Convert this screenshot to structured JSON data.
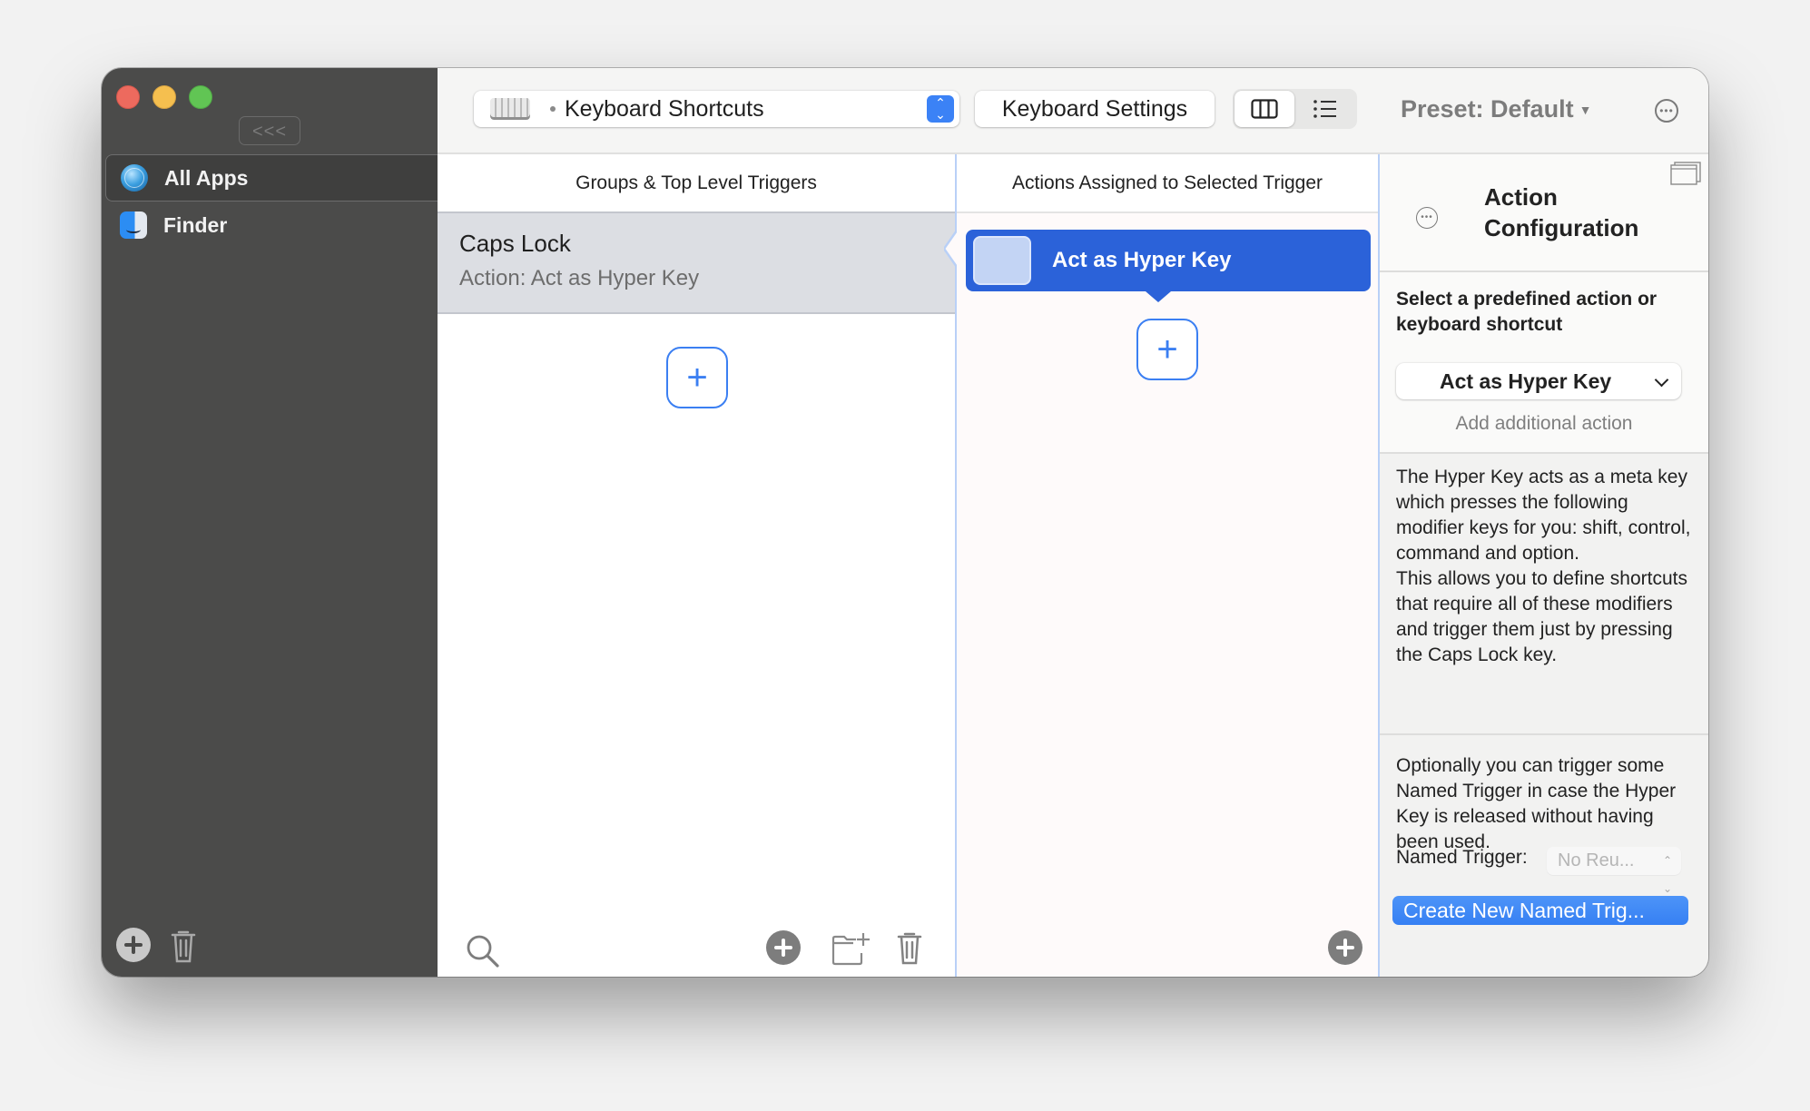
{
  "window": {
    "collapse_label": "<<<"
  },
  "sidebar": {
    "items": [
      {
        "label": "All Apps",
        "icon": "globe-icon",
        "selected": true
      },
      {
        "label": "Finder",
        "icon": "finder-icon",
        "selected": false
      }
    ]
  },
  "toolbar": {
    "trigger_type_popup": "Keyboard Shortcuts",
    "keyboard_settings_label": "Keyboard Settings",
    "view_modes": [
      "columns-view",
      "list-view"
    ],
    "selected_view": "columns-view",
    "preset_label": "Preset: Default",
    "accent": "#3b82f6"
  },
  "triggers_column": {
    "header": "Groups & Top Level Triggers",
    "items": [
      {
        "title": "Caps Lock",
        "subtitle": "Action: Act as Hyper Key",
        "selected": true
      }
    ],
    "add_symbol": "+"
  },
  "actions_column": {
    "header": "Actions Assigned to Selected Trigger",
    "items": [
      {
        "label": "Act as Hyper Key",
        "selected": true,
        "color": "#2b62d9"
      }
    ],
    "add_symbol": "+"
  },
  "config_panel": {
    "title": "Action Configuration",
    "title_line1": "Action",
    "title_line2": "Configuration",
    "select_heading": "Select a predefined action or keyboard shortcut",
    "selected_action": "Act as Hyper Key",
    "add_additional_action": "Add additional action",
    "description": "The Hyper Key acts as a meta key which presses the following modifier keys for you: shift, control, command and option.",
    "description2": "This allows you to define shortcuts that require all of these modifiers and trigger them just by pressing the Caps Lock key.",
    "optional_text": "Optionally you can trigger some Named Trigger in case the Hyper Key is released without having been used.",
    "named_trigger_label": "Named Trigger:",
    "named_trigger_value": "No Reu...",
    "create_button": "Create New Named Trig...",
    "button_color": "#3680f3"
  }
}
